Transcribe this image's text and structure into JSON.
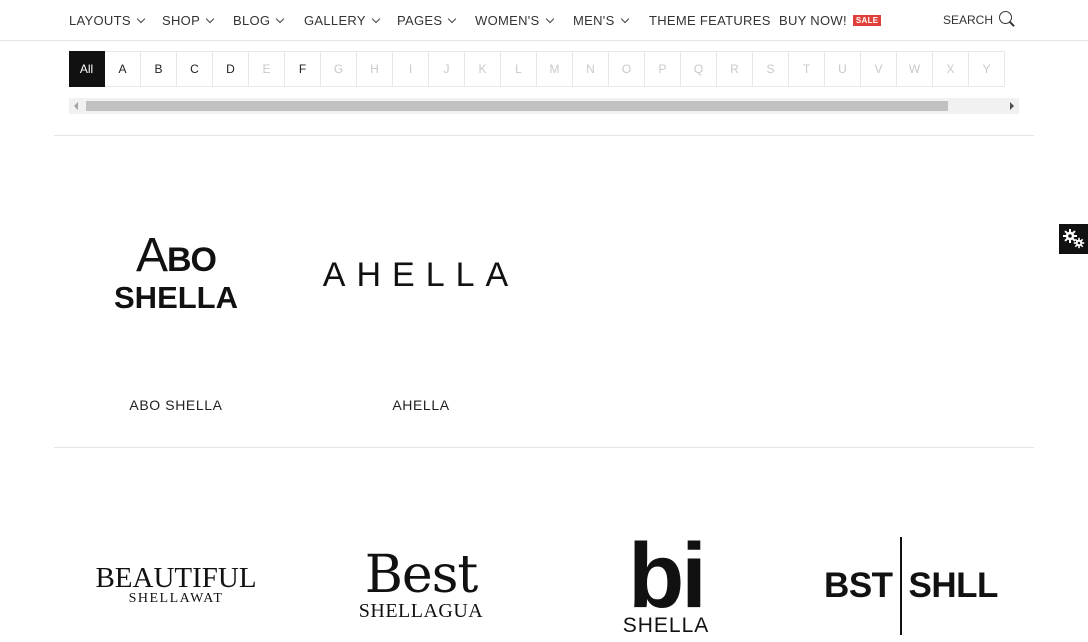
{
  "nav": {
    "items": [
      {
        "label": "LAYOUTS",
        "dropdown": true
      },
      {
        "label": "SHOP",
        "dropdown": true
      },
      {
        "label": "BLOG",
        "dropdown": true
      },
      {
        "label": "GALLERY",
        "dropdown": true
      },
      {
        "label": "PAGES",
        "dropdown": true
      },
      {
        "label": "WOMEN'S",
        "dropdown": true
      },
      {
        "label": "MEN'S",
        "dropdown": true
      },
      {
        "label": "THEME FEATURES",
        "dropdown": false
      },
      {
        "label": "BUY NOW!",
        "dropdown": false
      }
    ],
    "sale_badge": "SALE",
    "search_label": "SEARCH",
    "search_icon": "search-icon"
  },
  "alphabet": {
    "letters": [
      "All",
      "A",
      "B",
      "C",
      "D",
      "E",
      "F",
      "G",
      "H",
      "I",
      "J",
      "K",
      "L",
      "M",
      "N",
      "O",
      "P",
      "Q",
      "R",
      "S",
      "T",
      "U",
      "V",
      "W",
      "X",
      "Y"
    ],
    "active": "All",
    "enabled": [
      "All",
      "A",
      "B",
      "C",
      "D",
      "F"
    ]
  },
  "brands": [
    {
      "name": "ABO SHELLA",
      "logo_line1_big": "A",
      "logo_line1_small": "BO",
      "logo_line2": "SHELLA"
    },
    {
      "name": "AHELLA",
      "logo_text": "AHELLA"
    },
    {
      "logo_line1": "BEAUTIFUL",
      "logo_line2": "SHELLAWAT"
    },
    {
      "logo_line1": "Best",
      "logo_line2": "SHELLAGUA"
    },
    {
      "logo_line1": "bi",
      "logo_line2": "SHELLA"
    },
    {
      "logo_left": "BST",
      "logo_right": "SHLL"
    }
  ],
  "colors": {
    "accent": "#e0403a",
    "active_bg": "#111111",
    "disabled_text": "#c9c9c9"
  },
  "side_tab_icon": "gears-icon"
}
